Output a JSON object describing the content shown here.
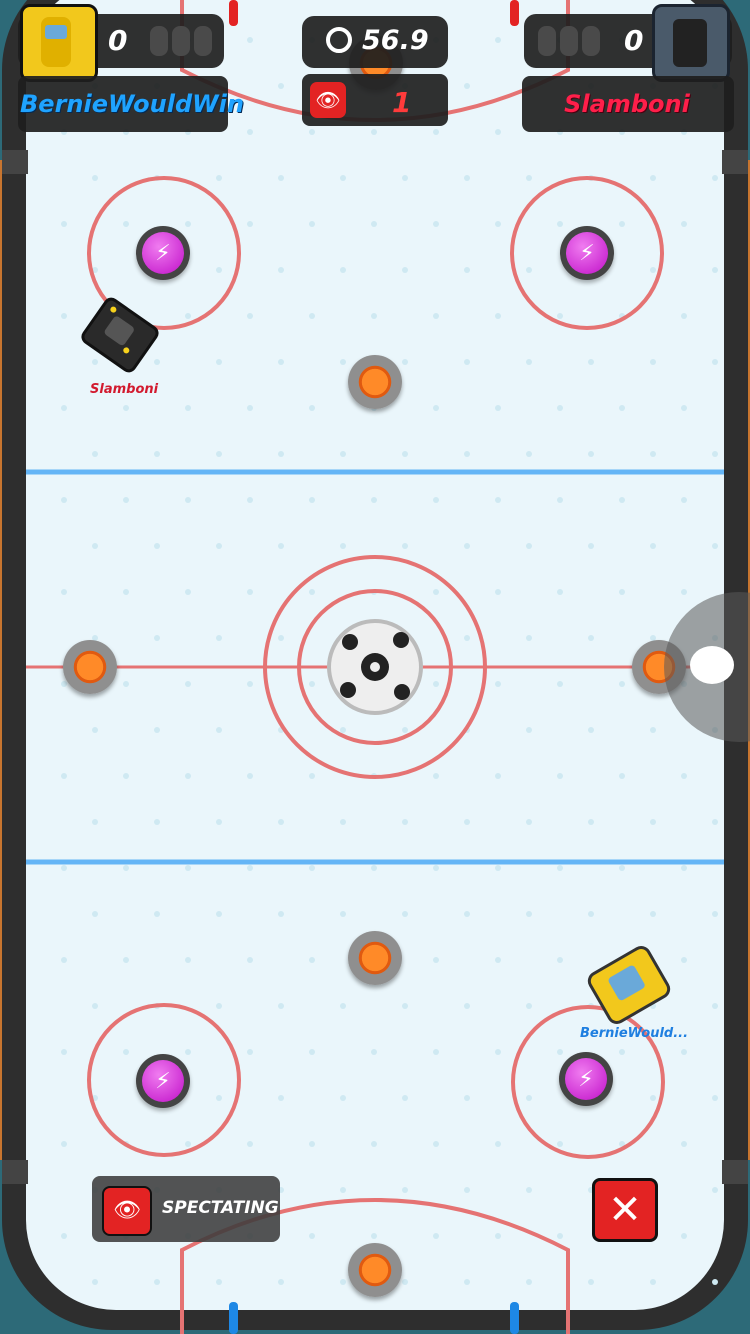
{
  "hud": {
    "left_player": {
      "name": "BernieWouldWin",
      "score": "0",
      "name_color": "#1fa3ff"
    },
    "right_player": {
      "name": "Slamboni",
      "score": "0",
      "name_color": "#ff1f4a"
    },
    "timer": "56.9",
    "spectators": "1"
  },
  "spectating_label": "SPECTATING",
  "car_labels": {
    "slamboni": "Slamboni",
    "bernie": "BernieWould..."
  },
  "colors": {
    "rink_line_red": "#e57373",
    "rink_line_blue": "#64b5f6",
    "ice": "#eaf6fb",
    "accent_red": "#e32323"
  },
  "icons": {
    "timer": "stopwatch-icon",
    "spectators": "eye-icon",
    "close": "close-icon",
    "chat": "chat-bubble-icon",
    "boost": "lightning-icon"
  }
}
